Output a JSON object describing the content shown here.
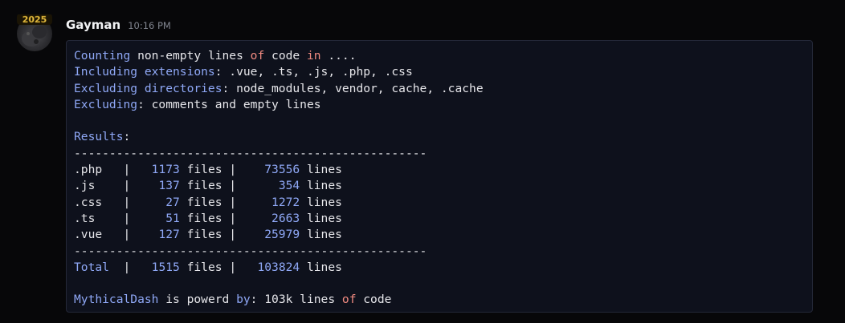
{
  "message": {
    "author": "Gayman",
    "timestamp": "10:16 PM",
    "avatar_badge": "2025"
  },
  "colors": {
    "background": "#070709",
    "code_background": "#0e111c",
    "code_border": "#242838",
    "keyword": "#8fa8f6",
    "operator": "#f08a80",
    "text": "#e6e6ea",
    "timestamp": "#80848e"
  },
  "code": {
    "l1": {
      "a": "Counting",
      "b": " non-empty lines ",
      "c": "of",
      "d": " code ",
      "e": "in",
      "f": " ...."
    },
    "l2": {
      "a": "Including extensions",
      "b": ": .vue, .ts, .js, .php, .css"
    },
    "l3": {
      "a": "Excluding directories",
      "b": ": node_modules, vendor, cache, .cache"
    },
    "l4": {
      "a": "Excluding",
      "b": ": comments and empty lines"
    },
    "l5": "",
    "l6": {
      "a": "Results",
      "b": ":"
    },
    "separator": "--------------------------------------------------",
    "rows": [
      {
        "ext": ".php   |   ",
        "files": "1173",
        "mid": " files |    ",
        "lines": "73556",
        "end": " lines"
      },
      {
        "ext": ".js    |    ",
        "files": "137",
        "mid": " files |      ",
        "lines": "354",
        "end": " lines"
      },
      {
        "ext": ".css   |     ",
        "files": "27",
        "mid": " files |     ",
        "lines": "1272",
        "end": " lines"
      },
      {
        "ext": ".ts    |     ",
        "files": "51",
        "mid": " files |     ",
        "lines": "2663",
        "end": " lines"
      },
      {
        "ext": ".vue   |    ",
        "files": "127",
        "mid": " files |    ",
        "lines": "25979",
        "end": " lines"
      }
    ],
    "total": {
      "label": "Total",
      "sep1": "  |   ",
      "files": "1515",
      "mid": " files |   ",
      "lines": "103824",
      "end": " lines"
    },
    "footer": {
      "a": "MythicalDash",
      "b": " is powerd ",
      "c": "by",
      "d": ": 103k lines ",
      "e": "of",
      "f": " code"
    }
  }
}
